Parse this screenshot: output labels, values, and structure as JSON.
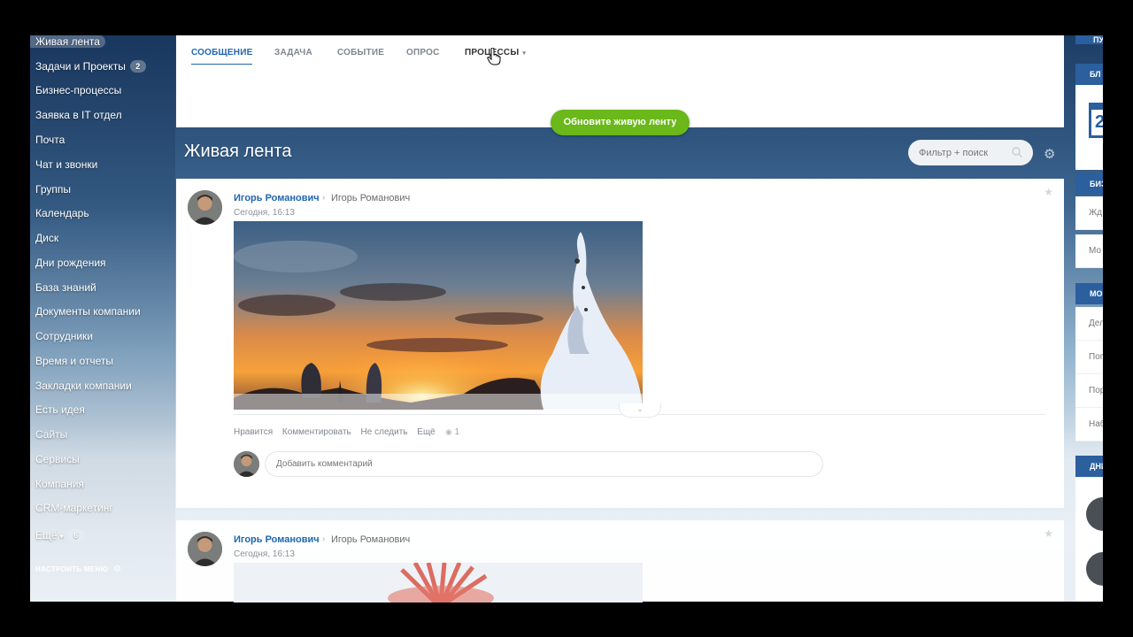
{
  "sidebar": {
    "items": [
      {
        "label": "Живая лента",
        "badge": ""
      },
      {
        "label": "Задачи и Проекты",
        "badge": "2"
      },
      {
        "label": "Бизнес-процессы",
        "badge": ""
      },
      {
        "label": "Заявка в IT отдел",
        "badge": ""
      },
      {
        "label": "Почта",
        "badge": ""
      },
      {
        "label": "Чат и звонки",
        "badge": ""
      },
      {
        "label": "Группы",
        "badge": ""
      },
      {
        "label": "Календарь",
        "badge": ""
      },
      {
        "label": "Диск",
        "badge": ""
      },
      {
        "label": "Дни рождения",
        "badge": ""
      },
      {
        "label": "База знаний",
        "badge": ""
      },
      {
        "label": "Документы компании",
        "badge": ""
      },
      {
        "label": "Сотрудники",
        "badge": ""
      },
      {
        "label": "Время и отчеты",
        "badge": ""
      },
      {
        "label": "Закладки компании",
        "badge": ""
      },
      {
        "label": "Есть идея",
        "badge": ""
      },
      {
        "label": "Сайты",
        "badge": ""
      },
      {
        "label": "Сервисы",
        "badge": ""
      },
      {
        "label": "Компания",
        "badge": ""
      },
      {
        "label": "CRM-маркетинг",
        "badge": ""
      },
      {
        "label": "Ещё",
        "badge": "6"
      }
    ],
    "config_label": "НАСТРОИТЬ МЕНЮ"
  },
  "composer": {
    "tabs": [
      "СООБЩЕНИЕ",
      "ЗАДАЧА",
      "СОБЫТИЕ",
      "ОПРОС",
      "ПРОЦЕССЫ"
    ],
    "active_tab": "СООБЩЕНИЕ"
  },
  "feed": {
    "update_button": "Обновите живую ленту",
    "title": "Живая лента",
    "search_placeholder": "Фильтр + поиск"
  },
  "posts": [
    {
      "author": "Игорь Романович",
      "recipient": "Игорь Романович",
      "time": "Сегодня, 16:13",
      "actions": [
        "Нравится",
        "Комментировать",
        "Не следить",
        "Ещё"
      ],
      "views": "1",
      "comment_placeholder": "Добавить комментарий"
    },
    {
      "author": "Игорь Романович",
      "recipient": "Игорь Романович",
      "time": "Сегодня, 16:13"
    }
  ],
  "right_panel": {
    "top": "ПУ",
    "sections": [
      {
        "head": "БЛ",
        "rows": []
      },
      {
        "head": "БИЗ",
        "rows": [
          "Жд",
          "Мо"
        ]
      },
      {
        "head": "МО",
        "rows": [
          "Дел",
          "Пог",
          "Пор",
          "Наб"
        ]
      },
      {
        "head": "ДНИ",
        "rows": []
      }
    ],
    "calendar_day": "2"
  },
  "colors": {
    "accent": "#2067b0",
    "update_green": "#6ab819",
    "panel_blue": "#2b5f9e"
  }
}
